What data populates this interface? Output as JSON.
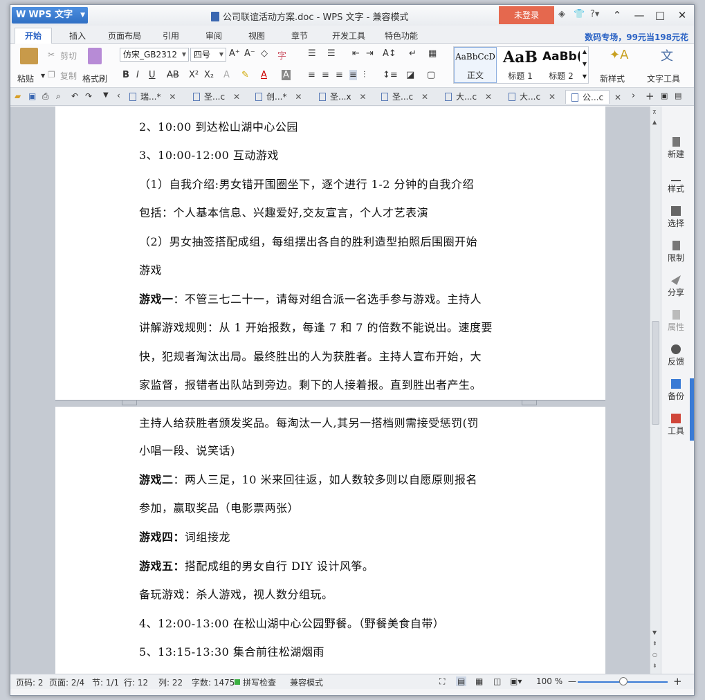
{
  "titlebar": {
    "app_name": "WPS 文字",
    "title": "公司联谊活动方案.doc - WPS 文字 - 兼容模式",
    "login": "未登录"
  },
  "tabs": [
    "开始",
    "插入",
    "页面布局",
    "引用",
    "审阅",
    "视图",
    "章节",
    "开发工具",
    "特色功能"
  ],
  "promo": "数码专场，99元当198元花",
  "ribbon": {
    "paste": "粘贴",
    "cut": "剪切",
    "copy": "复制",
    "format_painter": "格式刷",
    "font_name": "仿宋_GB2312",
    "font_size": "四号",
    "styles": [
      {
        "sample": "AaBbCcD",
        "label": "正文"
      },
      {
        "sample": "AaB",
        "label": "标题 1"
      },
      {
        "sample": "AaBb(",
        "label": "标题 2"
      }
    ],
    "new_style": "新样式",
    "text_tools": "文字工具"
  },
  "doc_tabs": [
    "瑞...*",
    "圣...c",
    "创...*",
    "圣...x",
    "圣...c",
    "大...c",
    "大...c",
    "公...c"
  ],
  "document": {
    "page1_lines": [
      {
        "bold": "",
        "text": "2、10:00 到达松山湖中心公园"
      },
      {
        "bold": "",
        "text": "3、10:00-12:00 互动游戏"
      },
      {
        "bold": "",
        "text": "（1）自我介绍:男女错开围圈坐下，逐个进行 1-2 分钟的自我介绍"
      },
      {
        "bold": "",
        "text": "包括：个人基本信息、兴趣爱好,交友宣言，个人才艺表演"
      },
      {
        "bold": "",
        "text": "（2）男女抽签搭配成组，每组摆出各自的胜利造型拍照后围圈开始"
      },
      {
        "bold": "",
        "text": "游戏"
      },
      {
        "bold": "游戏一",
        "text": "：不管三七二十一，请每对组合派一名选手参与游戏。主持人"
      },
      {
        "bold": "",
        "text": "讲解游戏规则：从 1 开始报数，每逢 7 和 7 的倍数不能说出。速度要"
      },
      {
        "bold": "",
        "text": "快，犯规者淘汰出局。最终胜出的人为获胜者。主持人宣布开始，大"
      },
      {
        "bold": "",
        "text": "家监督，报错者出队站到旁边。剩下的人接着报。直到胜出者产生。"
      }
    ],
    "page2_lines": [
      {
        "bold": "",
        "text": "主持人给获胜者颁发奖品。每淘汰一人,其另一搭档则需接受惩罚(罚"
      },
      {
        "bold": "",
        "text": "小唱一段、说笑话)"
      },
      {
        "bold": "游戏二",
        "text": "：两人三足，10 米来回往返，如人数较多则以自愿原则报名"
      },
      {
        "bold": "",
        "text": "参加，赢取奖品（电影票两张）"
      },
      {
        "bold": "游戏四：",
        "text": "词组接龙"
      },
      {
        "bold": "游戏五：",
        "text": "搭配成组的男女自行 DIY 设计风筝。"
      },
      {
        "bold": "",
        "text": "备玩游戏：杀人游戏，视人数分组玩。"
      },
      {
        "bold": "",
        "text": "4、12:00-13:00  在松山湖中心公园野餐。（野餐美食自带）"
      },
      {
        "bold": "",
        "text": "5、13:15-13:30  集合前往松湖烟雨"
      }
    ]
  },
  "taskpane": [
    {
      "label": "新建",
      "icon": "new-doc-icon",
      "enabled": true
    },
    {
      "label": "样式",
      "icon": "style-icon",
      "enabled": true
    },
    {
      "label": "选择",
      "icon": "select-icon",
      "enabled": true
    },
    {
      "label": "限制",
      "icon": "restrict-icon",
      "enabled": true
    },
    {
      "label": "分享",
      "icon": "share-icon",
      "enabled": true
    },
    {
      "label": "属性",
      "icon": "properties-icon",
      "enabled": false
    },
    {
      "label": "反馈",
      "icon": "feedback-icon",
      "enabled": true
    },
    {
      "label": "备份",
      "icon": "backup-icon",
      "enabled": true
    },
    {
      "label": "工具",
      "icon": "toolbox-icon",
      "enabled": true
    }
  ],
  "statusbar": {
    "page_num": "页码: 2",
    "page": "页面: 2/4",
    "section": "节: 1/1",
    "row": "行: 12",
    "col": "列: 22",
    "words": "字数: 1475",
    "spell": "拼写检查",
    "compat": "兼容模式",
    "zoom": "100 %"
  },
  "colors": {
    "accent": "#2a62c4",
    "login": "#e5684e"
  }
}
